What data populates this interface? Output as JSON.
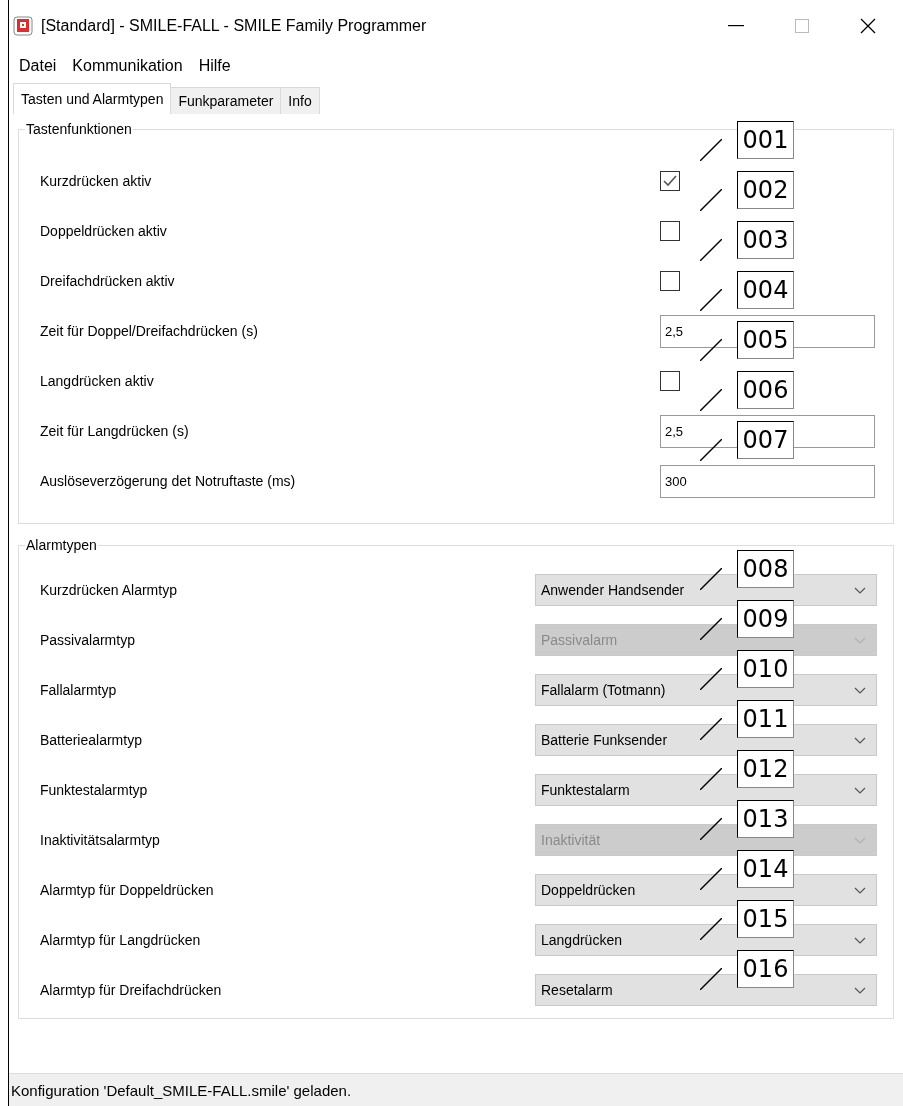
{
  "window": {
    "title": "[Standard] - SMILE-FALL - SMILE Family Programmer"
  },
  "menu": [
    "Datei",
    "Kommunikation",
    "Hilfe"
  ],
  "tabs": [
    {
      "label": "Tasten und Alarmtypen",
      "selected": true
    },
    {
      "label": "Funkparameter",
      "selected": false
    },
    {
      "label": "Info",
      "selected": false
    }
  ],
  "groups": [
    {
      "title": "Tastenfunktionen",
      "kind": "settings",
      "rows": [
        {
          "label": "Kurzdrücken aktiv",
          "kind": "checkbox",
          "checked": true,
          "callout": "001"
        },
        {
          "label": "Doppeldrücken aktiv",
          "kind": "checkbox",
          "checked": false,
          "callout": "002"
        },
        {
          "label": "Dreifachdrücken aktiv",
          "kind": "checkbox",
          "checked": false,
          "callout": "003"
        },
        {
          "label": "Zeit für Doppel/Dreifachdrücken (s)",
          "kind": "input",
          "value": "2,5",
          "callout": "004"
        },
        {
          "label": "Langdrücken aktiv",
          "kind": "checkbox",
          "checked": false,
          "callout": "005"
        },
        {
          "label": "Zeit für Langdrücken (s)",
          "kind": "input",
          "value": "2,5",
          "callout": "006"
        },
        {
          "label": "Auslöseverzögerung det Notruftaste (ms)",
          "kind": "input",
          "value": "300",
          "callout": "007"
        }
      ]
    },
    {
      "title": "Alarmtypen",
      "kind": "alarms",
      "rows": [
        {
          "label": "Kurzdrücken Alarmtyp",
          "kind": "select",
          "value": "Anwender Handsender",
          "disabled": false,
          "callout": "008"
        },
        {
          "label": "Passivalarmtyp",
          "kind": "select",
          "value": "Passivalarm",
          "disabled": true,
          "callout": "009"
        },
        {
          "label": "Fallalarmtyp",
          "kind": "select",
          "value": "Fallalarm (Totmann)",
          "disabled": false,
          "callout": "010"
        },
        {
          "label": "Batteriealarmtyp",
          "kind": "select",
          "value": "Batterie Funksender",
          "disabled": false,
          "callout": "011"
        },
        {
          "label": "Funktestalarmtyp",
          "kind": "select",
          "value": "Funktestalarm",
          "disabled": false,
          "callout": "012"
        },
        {
          "label": "Inaktivitätsalarmtyp",
          "kind": "select",
          "value": "Inaktivität",
          "disabled": true,
          "callout": "013"
        },
        {
          "label": "Alarmtyp für Doppeldrücken",
          "kind": "select",
          "value": "Doppeldrücken",
          "disabled": false,
          "callout": "014"
        },
        {
          "label": "Alarmtyp für Langdrücken",
          "kind": "select",
          "value": "Langdrücken",
          "disabled": false,
          "callout": "015"
        },
        {
          "label": "Alarmtyp für Dreifachdrücken",
          "kind": "select",
          "value": "Resetalarm",
          "disabled": false,
          "callout": "016"
        }
      ]
    }
  ],
  "status_bar": "Konfiguration 'Default_SMILE-FALL.smile' geladen."
}
